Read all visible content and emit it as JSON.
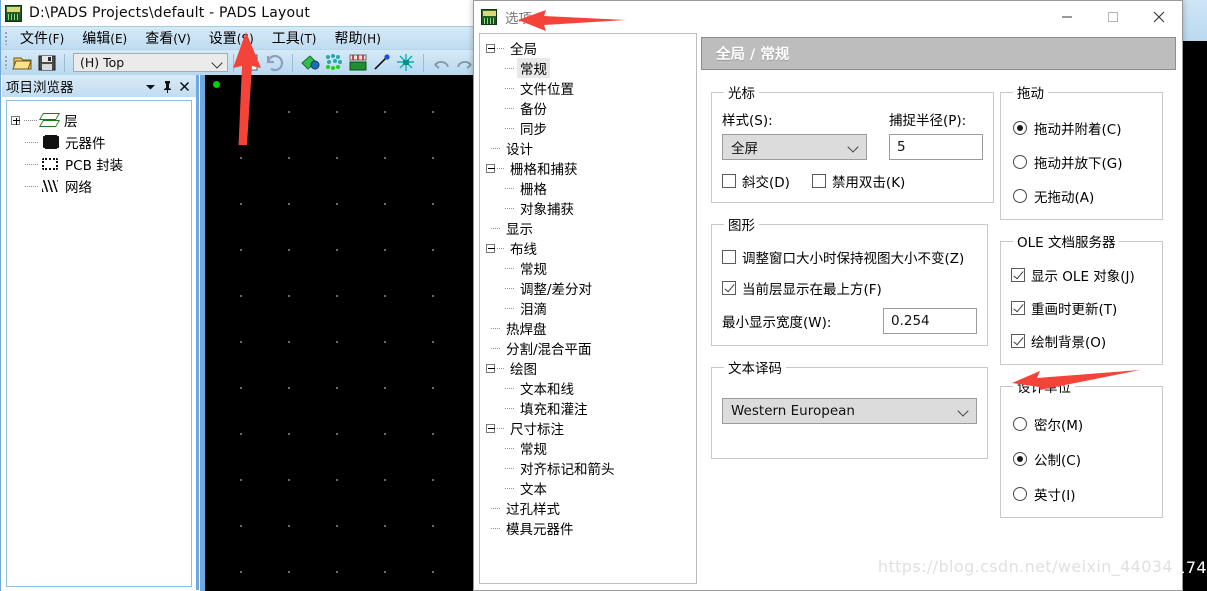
{
  "app": {
    "title": "D:\\PADS Projects\\default - PADS Layout",
    "icon": "pads-app-icon"
  },
  "menubar": [
    {
      "label": "文件",
      "mnemonic": "(F)"
    },
    {
      "label": "编辑",
      "mnemonic": "(E)"
    },
    {
      "label": "查看",
      "mnemonic": "(V)"
    },
    {
      "label": "设置",
      "mnemonic": "(S)"
    },
    {
      "label": "工具",
      "mnemonic": "(T)"
    },
    {
      "label": "帮助",
      "mnemonic": "(H)"
    }
  ],
  "toolbar": {
    "layer_value": "(H) Top",
    "icons": [
      "open-icon",
      "save-icon",
      "report-icon",
      "refresh-icon",
      "pour-icon",
      "cluster-icon",
      "board-icon",
      "route-icon",
      "fanout-icon",
      "undo-icon",
      "redo-icon",
      "zoom-icon"
    ]
  },
  "project_browser": {
    "title": "项目浏览器",
    "buttons": [
      "dropdown-icon",
      "pin-icon",
      "close-icon"
    ],
    "items": [
      {
        "label": "层",
        "icon": "layers-icon",
        "expandable": true
      },
      {
        "label": "元器件",
        "icon": "component-icon",
        "expandable": false
      },
      {
        "label": "PCB 封装",
        "icon": "footprint-icon",
        "expandable": false
      },
      {
        "label": "网络",
        "icon": "net-icon",
        "expandable": false
      }
    ]
  },
  "dialog": {
    "title": "选项",
    "window_buttons": [
      "minimize-icon",
      "maximize-icon",
      "close-icon"
    ],
    "panel_header": "全局 / 常规",
    "tree": [
      {
        "label": "全局",
        "level": 0,
        "expander": "minus"
      },
      {
        "label": "常规",
        "level": 1,
        "selected": true
      },
      {
        "label": "文件位置",
        "level": 1
      },
      {
        "label": "备份",
        "level": 1
      },
      {
        "label": "同步",
        "level": 1
      },
      {
        "label": "设计",
        "level": 0
      },
      {
        "label": "栅格和捕获",
        "level": 0,
        "expander": "minus"
      },
      {
        "label": "栅格",
        "level": 1
      },
      {
        "label": "对象捕获",
        "level": 1
      },
      {
        "label": "显示",
        "level": 0
      },
      {
        "label": "布线",
        "level": 0,
        "expander": "minus"
      },
      {
        "label": "常规",
        "level": 1
      },
      {
        "label": "调整/差分对",
        "level": 1
      },
      {
        "label": "泪滴",
        "level": 1
      },
      {
        "label": "热焊盘",
        "level": 0
      },
      {
        "label": "分割/混合平面",
        "level": 0
      },
      {
        "label": "绘图",
        "level": 0,
        "expander": "minus"
      },
      {
        "label": "文本和线",
        "level": 1
      },
      {
        "label": "填充和灌注",
        "level": 1
      },
      {
        "label": "尺寸标注",
        "level": 0,
        "expander": "minus"
      },
      {
        "label": "常规",
        "level": 1
      },
      {
        "label": "对齐标记和箭头",
        "level": 1
      },
      {
        "label": "文本",
        "level": 1
      },
      {
        "label": "过孔样式",
        "level": 0
      },
      {
        "label": "模具元器件",
        "level": 0
      }
    ],
    "groups": {
      "cursor": {
        "legend": "光标",
        "style_label": "样式(S):",
        "style_value": "全屏",
        "snap_label": "捕捉半径(P):",
        "snap_value": "5",
        "diagonal": {
          "label": "斜交(D)",
          "checked": false
        },
        "disable_dblclick": {
          "label": "禁用双击(K)",
          "checked": false
        }
      },
      "graphics": {
        "legend": "图形",
        "keep_view": {
          "label": "调整窗口大小时保持视图大小不变(Z)",
          "checked": false
        },
        "current_layer_top": {
          "label": "当前层显示在最上方(F)",
          "checked": true
        },
        "min_width_label": "最小显示宽度(W):",
        "min_width_value": "0.254"
      },
      "text_decode": {
        "legend": "文本译码",
        "value": "Western European"
      },
      "drag": {
        "legend": "拖动",
        "options": [
          {
            "label": "拖动并附着(C)",
            "selected": true
          },
          {
            "label": "拖动并放下(G)",
            "selected": false
          },
          {
            "label": "无拖动(A)",
            "selected": false
          }
        ]
      },
      "ole": {
        "legend": "OLE 文档服务器",
        "show_ole": {
          "label": "显示 OLE 对象(J)",
          "checked": true
        },
        "update_redraw": {
          "label": "重画时更新(T)",
          "checked": true
        },
        "draw_background": {
          "label": "绘制背景(O)",
          "checked": true
        }
      },
      "units": {
        "legend": "设计单位",
        "options": [
          {
            "label": "密尔(M)",
            "selected": false
          },
          {
            "label": "公制(C)",
            "selected": true
          },
          {
            "label": "英寸(I)",
            "selected": false
          }
        ]
      }
    }
  },
  "annotations": {
    "arrow_color": "#f4443a",
    "arrow_tools_target": "工具(T)",
    "arrow_title_target": "选项",
    "arrow_units_target": "公制(C)"
  },
  "watermark": {
    "text": "https://blog.csdn.net/weixin_44034",
    "tail": "174"
  },
  "colors": {
    "canvas_bg": "#000000",
    "panel_border": "#6fa8dc",
    "header_bar": "#bdbdbd",
    "accent": "#f4443a"
  }
}
